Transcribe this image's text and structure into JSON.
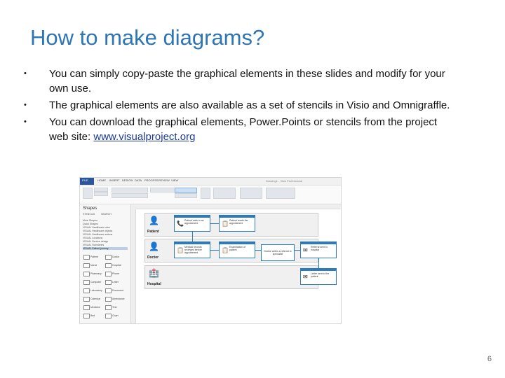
{
  "slide": {
    "title": "How to make diagrams?",
    "bullets": [
      {
        "marker": "•",
        "text": "You can simply copy-paste the graphical elements in these slides and modify for your own use."
      },
      {
        "marker": "•",
        "text": "The graphical elements are also available as a set of stencils in Visio and Omnigraffle."
      },
      {
        "marker": "•",
        "text_before": "You can download the graphical elements, Power.Points or stencils from the project web site: ",
        "link": "www.visualproject.org"
      }
    ],
    "page_number": "6"
  },
  "screenshot": {
    "menu": [
      "FILE",
      "HOME",
      "INSERT",
      "DESIGN",
      "DATA",
      "PROCESS",
      "REVIEW",
      "VIEW"
    ],
    "doc_title": "Drawing1 - Visio Professional",
    "shapes_pane": {
      "title": "Shapes",
      "tabs": [
        "STENCILS",
        "SEARCH"
      ],
      "stencils": [
        "More Shapes",
        "Quick Shapes",
        "VISUAL Healthcare roles",
        "VISUAL Healthcare objects",
        "VISUAL Healthcare actions",
        "VISUAL Locations",
        "VISUAL Service design",
        "VISUAL Swimlanes",
        "VISUAL Patient journey"
      ],
      "selected_index": 8,
      "shape_labels": [
        "Patient",
        "Doctor",
        "Nurse",
        "Hospital",
        "Pharmacy",
        "Phone",
        "Computer",
        "Letter",
        "Laboratory",
        "Document",
        "Calendar",
        "Ambulance",
        "Medicine",
        "Test",
        "Bed",
        "Chart"
      ]
    },
    "diagram": {
      "lanes": [
        {
          "label": "Patient",
          "icon": "👤"
        },
        {
          "label": "Doctor",
          "icon": "👤"
        },
        {
          "label": "Hospital",
          "icon": "🏥"
        }
      ],
      "boxes": [
        {
          "icon": "📞",
          "text": "Patient calls to an appointment"
        },
        {
          "icon": "📋",
          "text": "Patient reads the appointment"
        },
        {
          "icon": "📋",
          "text": "Medical records reviewed before appointment"
        },
        {
          "icon": "📋",
          "text": "Examination of patient"
        },
        {
          "icon": "",
          "text": "Doctor writes a referral to specialist"
        },
        {
          "icon": "✉",
          "text": "Referral sent to hospital"
        },
        {
          "icon": "✉",
          "text": "Letter sent to the patient"
        }
      ]
    }
  }
}
